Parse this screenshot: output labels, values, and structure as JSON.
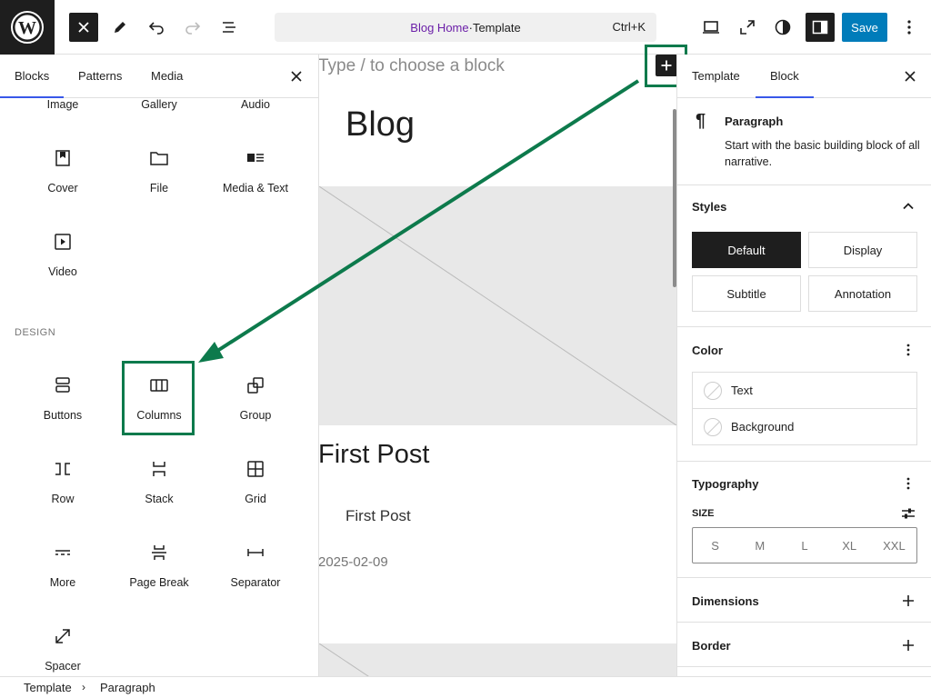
{
  "topbar": {
    "command_title": "Blog Home",
    "command_sep": " · ",
    "command_type": "Template",
    "command_shortcut": "Ctrl+K",
    "save_label": "Save"
  },
  "inserter": {
    "tabs": [
      "Blocks",
      "Patterns",
      "Media"
    ],
    "top_partial_items": [
      "Image",
      "Gallery",
      "Audio"
    ],
    "media_items": [
      {
        "label": "Cover",
        "icon": "cover-icon"
      },
      {
        "label": "File",
        "icon": "file-icon"
      },
      {
        "label": "Media & Text",
        "icon": "media-text-icon"
      },
      {
        "label": "Video",
        "icon": "video-icon"
      }
    ],
    "design_label": "DESIGN",
    "design_items": [
      {
        "label": "Buttons",
        "icon": "buttons-icon"
      },
      {
        "label": "Columns",
        "icon": "columns-icon"
      },
      {
        "label": "Group",
        "icon": "group-icon"
      },
      {
        "label": "Row",
        "icon": "row-icon"
      },
      {
        "label": "Stack",
        "icon": "stack-icon"
      },
      {
        "label": "Grid",
        "icon": "grid-icon"
      },
      {
        "label": "More",
        "icon": "more-icon"
      },
      {
        "label": "Page Break",
        "icon": "page-break-icon"
      },
      {
        "label": "Separator",
        "icon": "separator-icon"
      },
      {
        "label": "Spacer",
        "icon": "spacer-icon"
      }
    ]
  },
  "canvas": {
    "placeholder": "Type / to choose a block",
    "site_title": "Blog",
    "post_title": "First Post",
    "post_subtitle": "First Post",
    "post_date": "2025-02-09"
  },
  "settings": {
    "tabs": [
      "Template",
      "Block"
    ],
    "block_name": "Paragraph",
    "block_desc": "Start with the basic building block of all narrative.",
    "styles_label": "Styles",
    "style_options": [
      "Default",
      "Display",
      "Subtitle",
      "Annotation"
    ],
    "color_label": "Color",
    "color_items": [
      "Text",
      "Background"
    ],
    "typography_label": "Typography",
    "size_label": "SIZE",
    "sizes": [
      "S",
      "M",
      "L",
      "XL",
      "XXL"
    ],
    "dimensions_label": "Dimensions",
    "border_label": "Border"
  },
  "footer": {
    "crumbs": [
      "Template",
      "Paragraph"
    ]
  },
  "colors": {
    "accent": "#007cba",
    "tab_underline": "#3858e9",
    "annotation_green": "#0d7a4c",
    "command_purple": "#6b1fa8"
  }
}
